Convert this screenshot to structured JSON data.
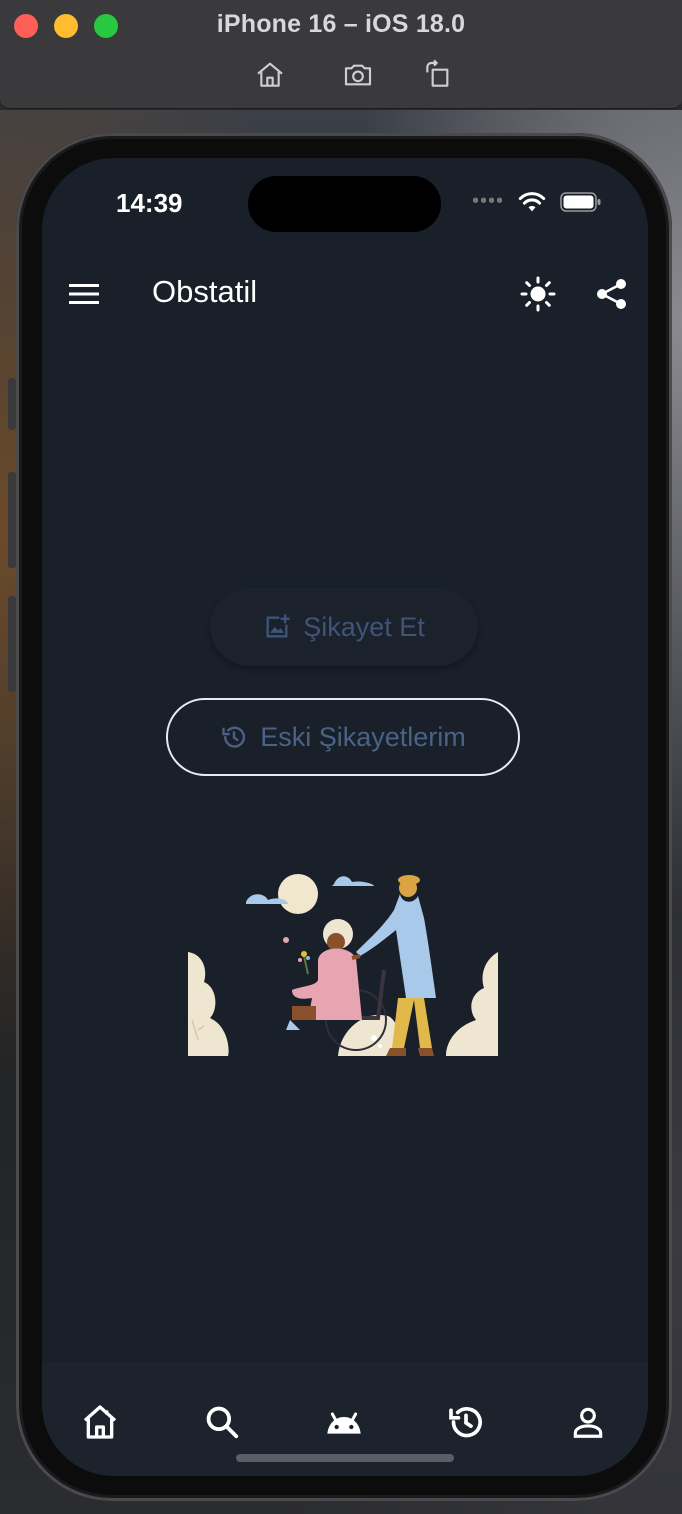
{
  "simulator": {
    "title": "iPhone 16 – iOS 18.0",
    "tools": [
      "home-icon",
      "screenshot-icon",
      "rotate-icon"
    ]
  },
  "status_bar": {
    "time": "14:39",
    "icons": [
      "wifi-icon",
      "battery-icon"
    ]
  },
  "app_bar": {
    "title": "Obstatil",
    "icons": [
      "menu-icon",
      "brightness-icon",
      "share-icon"
    ]
  },
  "actions": {
    "complain_label": "Şikayet Et",
    "history_label": "Eski Şikayetlerim"
  },
  "bottom_nav": {
    "items": [
      "home-icon",
      "search-icon",
      "android-icon",
      "history-icon",
      "person-icon"
    ]
  },
  "colors": {
    "background": "#19202a",
    "disabled_text": "#3e5478",
    "outline": "#e8ecf2"
  }
}
